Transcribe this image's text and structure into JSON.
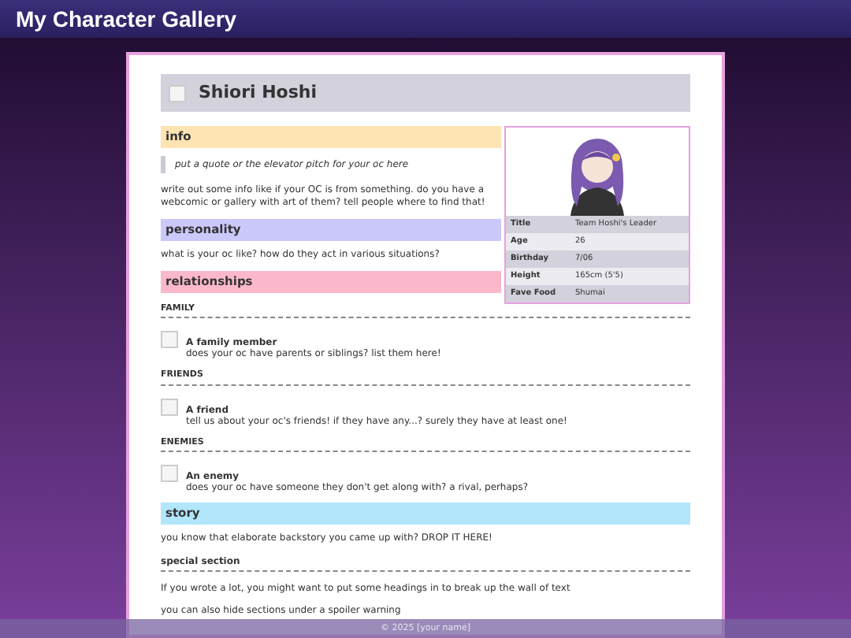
{
  "header": {
    "title": "My Character Gallery"
  },
  "profile": {
    "name": "Shiori Hoshi"
  },
  "infobox": {
    "rows": [
      {
        "label": "Title",
        "value": "Team Hoshi's Leader"
      },
      {
        "label": "Age",
        "value": "26"
      },
      {
        "label": "Birthday",
        "value": "7/06"
      },
      {
        "label": "Height",
        "value": "165cm (5'5)"
      },
      {
        "label": "Fave Food",
        "value": "Shumai"
      }
    ]
  },
  "sections": [
    {
      "heading": "info",
      "color": "#ffe4b3",
      "blocks": [
        {
          "kind": "quote",
          "text": "put a quote or the elevator pitch for your oc here"
        },
        {
          "kind": "paragraph",
          "text": "write out some info like if your OC is from something. do you have a webcomic or gallery with art of them? tell people where to find that!"
        }
      ]
    },
    {
      "heading": "personality",
      "color": "#cbc8fb",
      "blocks": [
        {
          "kind": "paragraph",
          "text": "what is your oc like? how do they act in various situations?"
        }
      ]
    },
    {
      "heading": "relationships",
      "color": "#fcb8cb",
      "blocks": [
        {
          "kind": "group",
          "title": "FAMILY",
          "name": "A family member",
          "text": "does your oc have parents or siblings? list them here!"
        },
        {
          "kind": "group",
          "title": "FRIENDS",
          "name": "A friend",
          "text": "tell us about your oc's friends! if they have any...? surely they have at least one!"
        },
        {
          "kind": "group",
          "title": "ENEMIES",
          "name": "An enemy",
          "text": "does your oc have someone they don't get along with? a rival, perhaps?"
        }
      ]
    },
    {
      "heading": "story",
      "color": "#b1e6fb",
      "blocks": [
        {
          "kind": "paragraph",
          "text": "you know that elaborate backstory you came up with? DROP IT HERE!"
        },
        {
          "kind": "subheading",
          "text": "special section"
        },
        {
          "kind": "paragraph",
          "text": "If you wrote a lot, you might want to put some headings in to break up the wall of text"
        },
        {
          "kind": "paragraph",
          "text": "you can also hide sections under a spoiler warning"
        }
      ]
    }
  ],
  "footer": {
    "text": "© 2025 [your name]"
  }
}
